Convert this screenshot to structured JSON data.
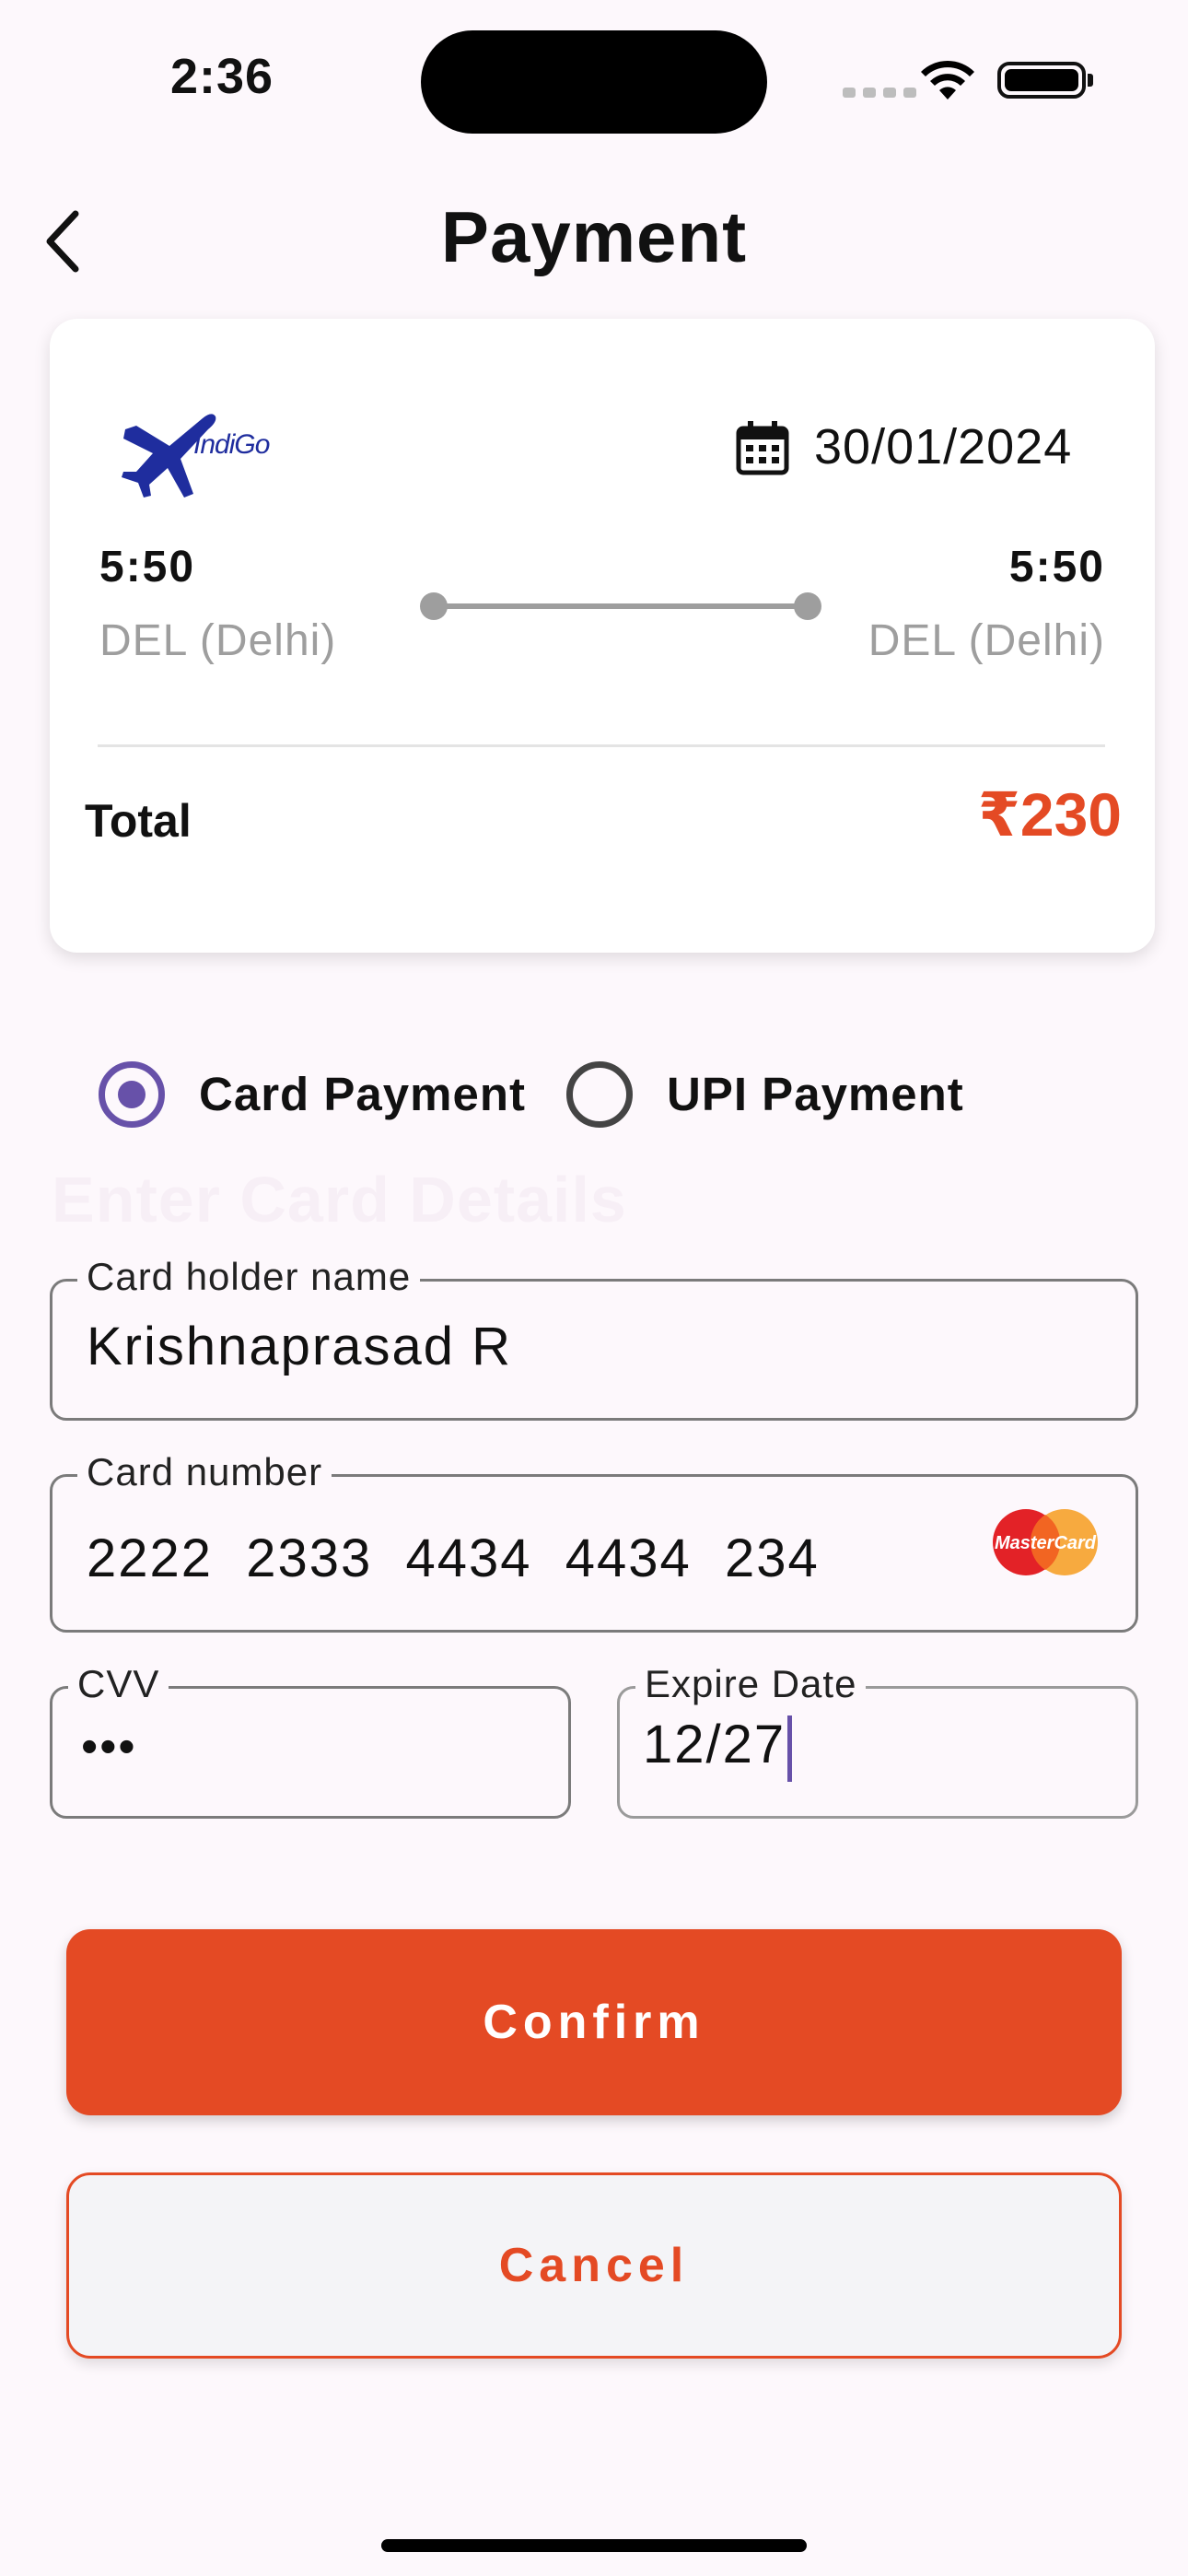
{
  "status_bar": {
    "time": "2:36"
  },
  "header": {
    "title": "Payment"
  },
  "flight": {
    "airline": "IndiGo",
    "date": "30/01/2024",
    "departure_time": "5:50",
    "departure_city": "DEL (Delhi)",
    "arrival_time": "5:50",
    "arrival_city": "DEL (Delhi)",
    "total_label": "Total",
    "total_value": "₹230"
  },
  "payment_options": {
    "card_label": "Card Payment",
    "upi_label": "UPI Payment",
    "selected": "card"
  },
  "form": {
    "heading": "Enter Card Details",
    "holder_label": "Card holder name",
    "holder_value": "Krishnaprasad R",
    "number_label": "Card number",
    "number_value": "2222  2333  4434  4434  234",
    "card_brand": "MasterCard",
    "cvv_label": "CVV",
    "cvv_value": "•••",
    "expiry_label": "Expire Date",
    "expiry_value": "12/27"
  },
  "actions": {
    "confirm_label": "Confirm",
    "cancel_label": "Cancel"
  },
  "colors": {
    "accent": "#e44a24",
    "radio": "#6751a9",
    "background": "#fdf8fc"
  }
}
